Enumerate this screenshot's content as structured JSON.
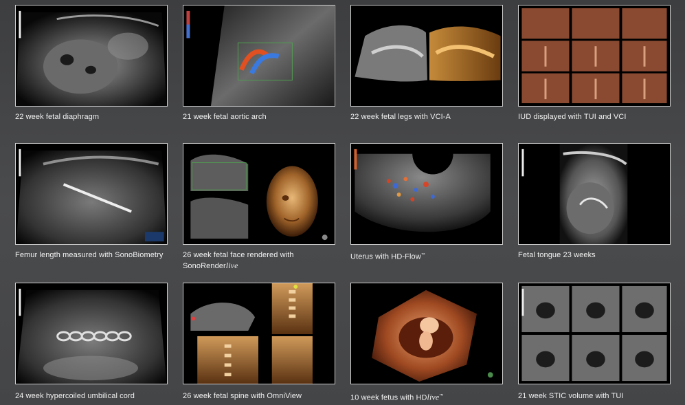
{
  "gallery": {
    "items": [
      {
        "caption": "22 week fetal diaphragm"
      },
      {
        "caption": "21 week fetal aortic arch"
      },
      {
        "caption": "22 week fetal legs with VCI-A"
      },
      {
        "caption": "IUD displayed with TUI and VCI"
      },
      {
        "caption": "Femur length measured with SonoBiometry"
      },
      {
        "caption_a": "26 week fetal face rendered with",
        "caption_b": "SonoRender",
        "caption_c": "live"
      },
      {
        "caption_a": "Uterus with HD-Flow",
        "caption_tm": "™"
      },
      {
        "caption": "Fetal tongue 23 weeks"
      },
      {
        "caption": "24 week hypercoiled umbilical cord"
      },
      {
        "caption": "26 week fetal spine with OmniView"
      },
      {
        "caption_a": "10 week fetus with HD",
        "caption_b": "live",
        "caption_tm": "™"
      },
      {
        "caption": "21 week STIC volume with TUI"
      }
    ]
  }
}
